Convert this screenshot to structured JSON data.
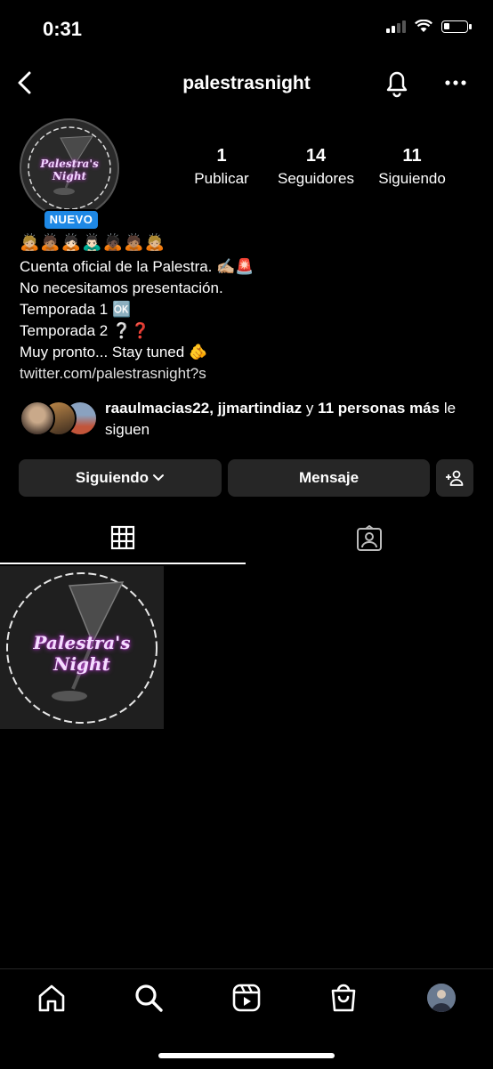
{
  "status": {
    "time": "0:31"
  },
  "header": {
    "username": "palestrasnight"
  },
  "profile": {
    "avatar_text": "Palestra's Night",
    "badge": "NUEVO",
    "stats": [
      {
        "num": "1",
        "label": "Publicar"
      },
      {
        "num": "14",
        "label": "Seguidores"
      },
      {
        "num": "11",
        "label": "Siguiendo"
      }
    ]
  },
  "bio": {
    "emoji_row": "🙇🏼🙇🏽🙇🏻🙇🏻‍♂️🙇🏿🙇🏽🙇🏼",
    "lines": [
      "Cuenta oficial de la Palestra. ✍🏼🚨",
      "No necesitamos presentación.",
      "Temporada 1 🆗",
      "Temporada 2 ❔❓",
      "Muy pronto... Stay tuned 🫵"
    ],
    "link": "twitter.com/palestrasnight?s"
  },
  "followed_by": {
    "names": "raaulmacias22, jjmartindiaz",
    "connector": " y ",
    "others": "11 personas más",
    "suffix": " le siguen"
  },
  "actions": {
    "following_label": "Siguiendo",
    "message_label": "Mensaje"
  },
  "post": {
    "text": "Palestra's Night"
  }
}
